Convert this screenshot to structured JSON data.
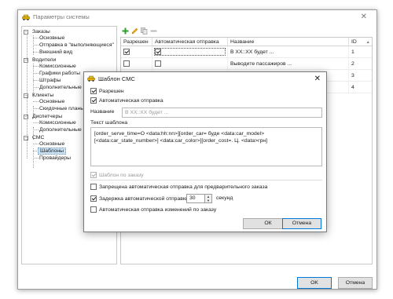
{
  "window": {
    "title": "Параметры системы",
    "close_glyph": "✕"
  },
  "tree": {
    "expander_glyph": "−",
    "nodes": [
      {
        "label": "Заказы",
        "level": 0
      },
      {
        "label": "Основные",
        "level": 1
      },
      {
        "label": "Отправка в \"выполняющиеся\"",
        "level": 1
      },
      {
        "label": "Внешний вид",
        "level": 1
      },
      {
        "label": "Водители",
        "level": 0
      },
      {
        "label": "Комиссионные",
        "level": 1
      },
      {
        "label": "Графики работы",
        "level": 1
      },
      {
        "label": "Штрафы",
        "level": 1
      },
      {
        "label": "Дополнительные",
        "level": 1
      },
      {
        "label": "Клиенты",
        "level": 0
      },
      {
        "label": "Основные",
        "level": 1
      },
      {
        "label": "Скидочные планы",
        "level": 1
      },
      {
        "label": "Диспетчеры",
        "level": 0
      },
      {
        "label": "Комиссионные",
        "level": 1
      },
      {
        "label": "Дополнительные",
        "level": 1
      },
      {
        "label": "СМС",
        "level": 0
      },
      {
        "label": "Основные",
        "level": 1
      },
      {
        "label": "Шаблоны",
        "level": 1,
        "selected": true
      },
      {
        "label": "Провайдеры",
        "level": 1
      }
    ]
  },
  "toolbar": {
    "icons": [
      "add-icon",
      "edit-icon",
      "copy-icon",
      "delete-icon"
    ]
  },
  "grid": {
    "columns": [
      "Разрешен",
      "Автоматическая отправка",
      "Название",
      "ID"
    ],
    "sort_glyph": "▲",
    "rows": [
      {
        "enabled": true,
        "auto": true,
        "name": "В XX::XX будет ...",
        "id": "1"
      },
      {
        "enabled": false,
        "auto": false,
        "name": "Выводите пассажиров ...",
        "id": "2"
      },
      {
        "enabled": false,
        "auto": false,
        "name": "",
        "id": "3"
      },
      {
        "enabled": false,
        "auto": false,
        "name": "",
        "id": "4"
      }
    ]
  },
  "footer": {
    "ok_label": "OK",
    "cancel_label": "Отмена"
  },
  "dialog": {
    "title": "Шаблон СМС",
    "close_glyph": "✕",
    "enabled_label": "Разрешен",
    "enabled_checked": true,
    "auto_label": "Автоматическая отправка",
    "auto_checked": true,
    "name_label": "Название",
    "name_value": "В XX::XX будет ...",
    "template_label": "Текст шаблона",
    "template_text": "[order_serve_time=О <data:hh:nn>][order_car= буде <data:car_model>\n[<data:car_state_number>] <data:car_color>][order_cost=. Ц. <data>грн]",
    "on_order_label": "Шаблон по заказу",
    "on_order_checked": true,
    "forbid_preorder_label": "Запрещена автоматическая отправка для предварительного заказа",
    "forbid_preorder_checked": false,
    "delay_label": "Задержка автоматической отправки",
    "delay_checked": true,
    "delay_value": "30",
    "delay_unit": "секунд",
    "auto_changes_label": "Автоматическая отправка изменений по заказу",
    "auto_changes_checked": false,
    "ok_label": "ОК",
    "cancel_label": "Отмена"
  },
  "colors": {
    "accent": "#0078d7",
    "selection": "#cce4f7"
  }
}
